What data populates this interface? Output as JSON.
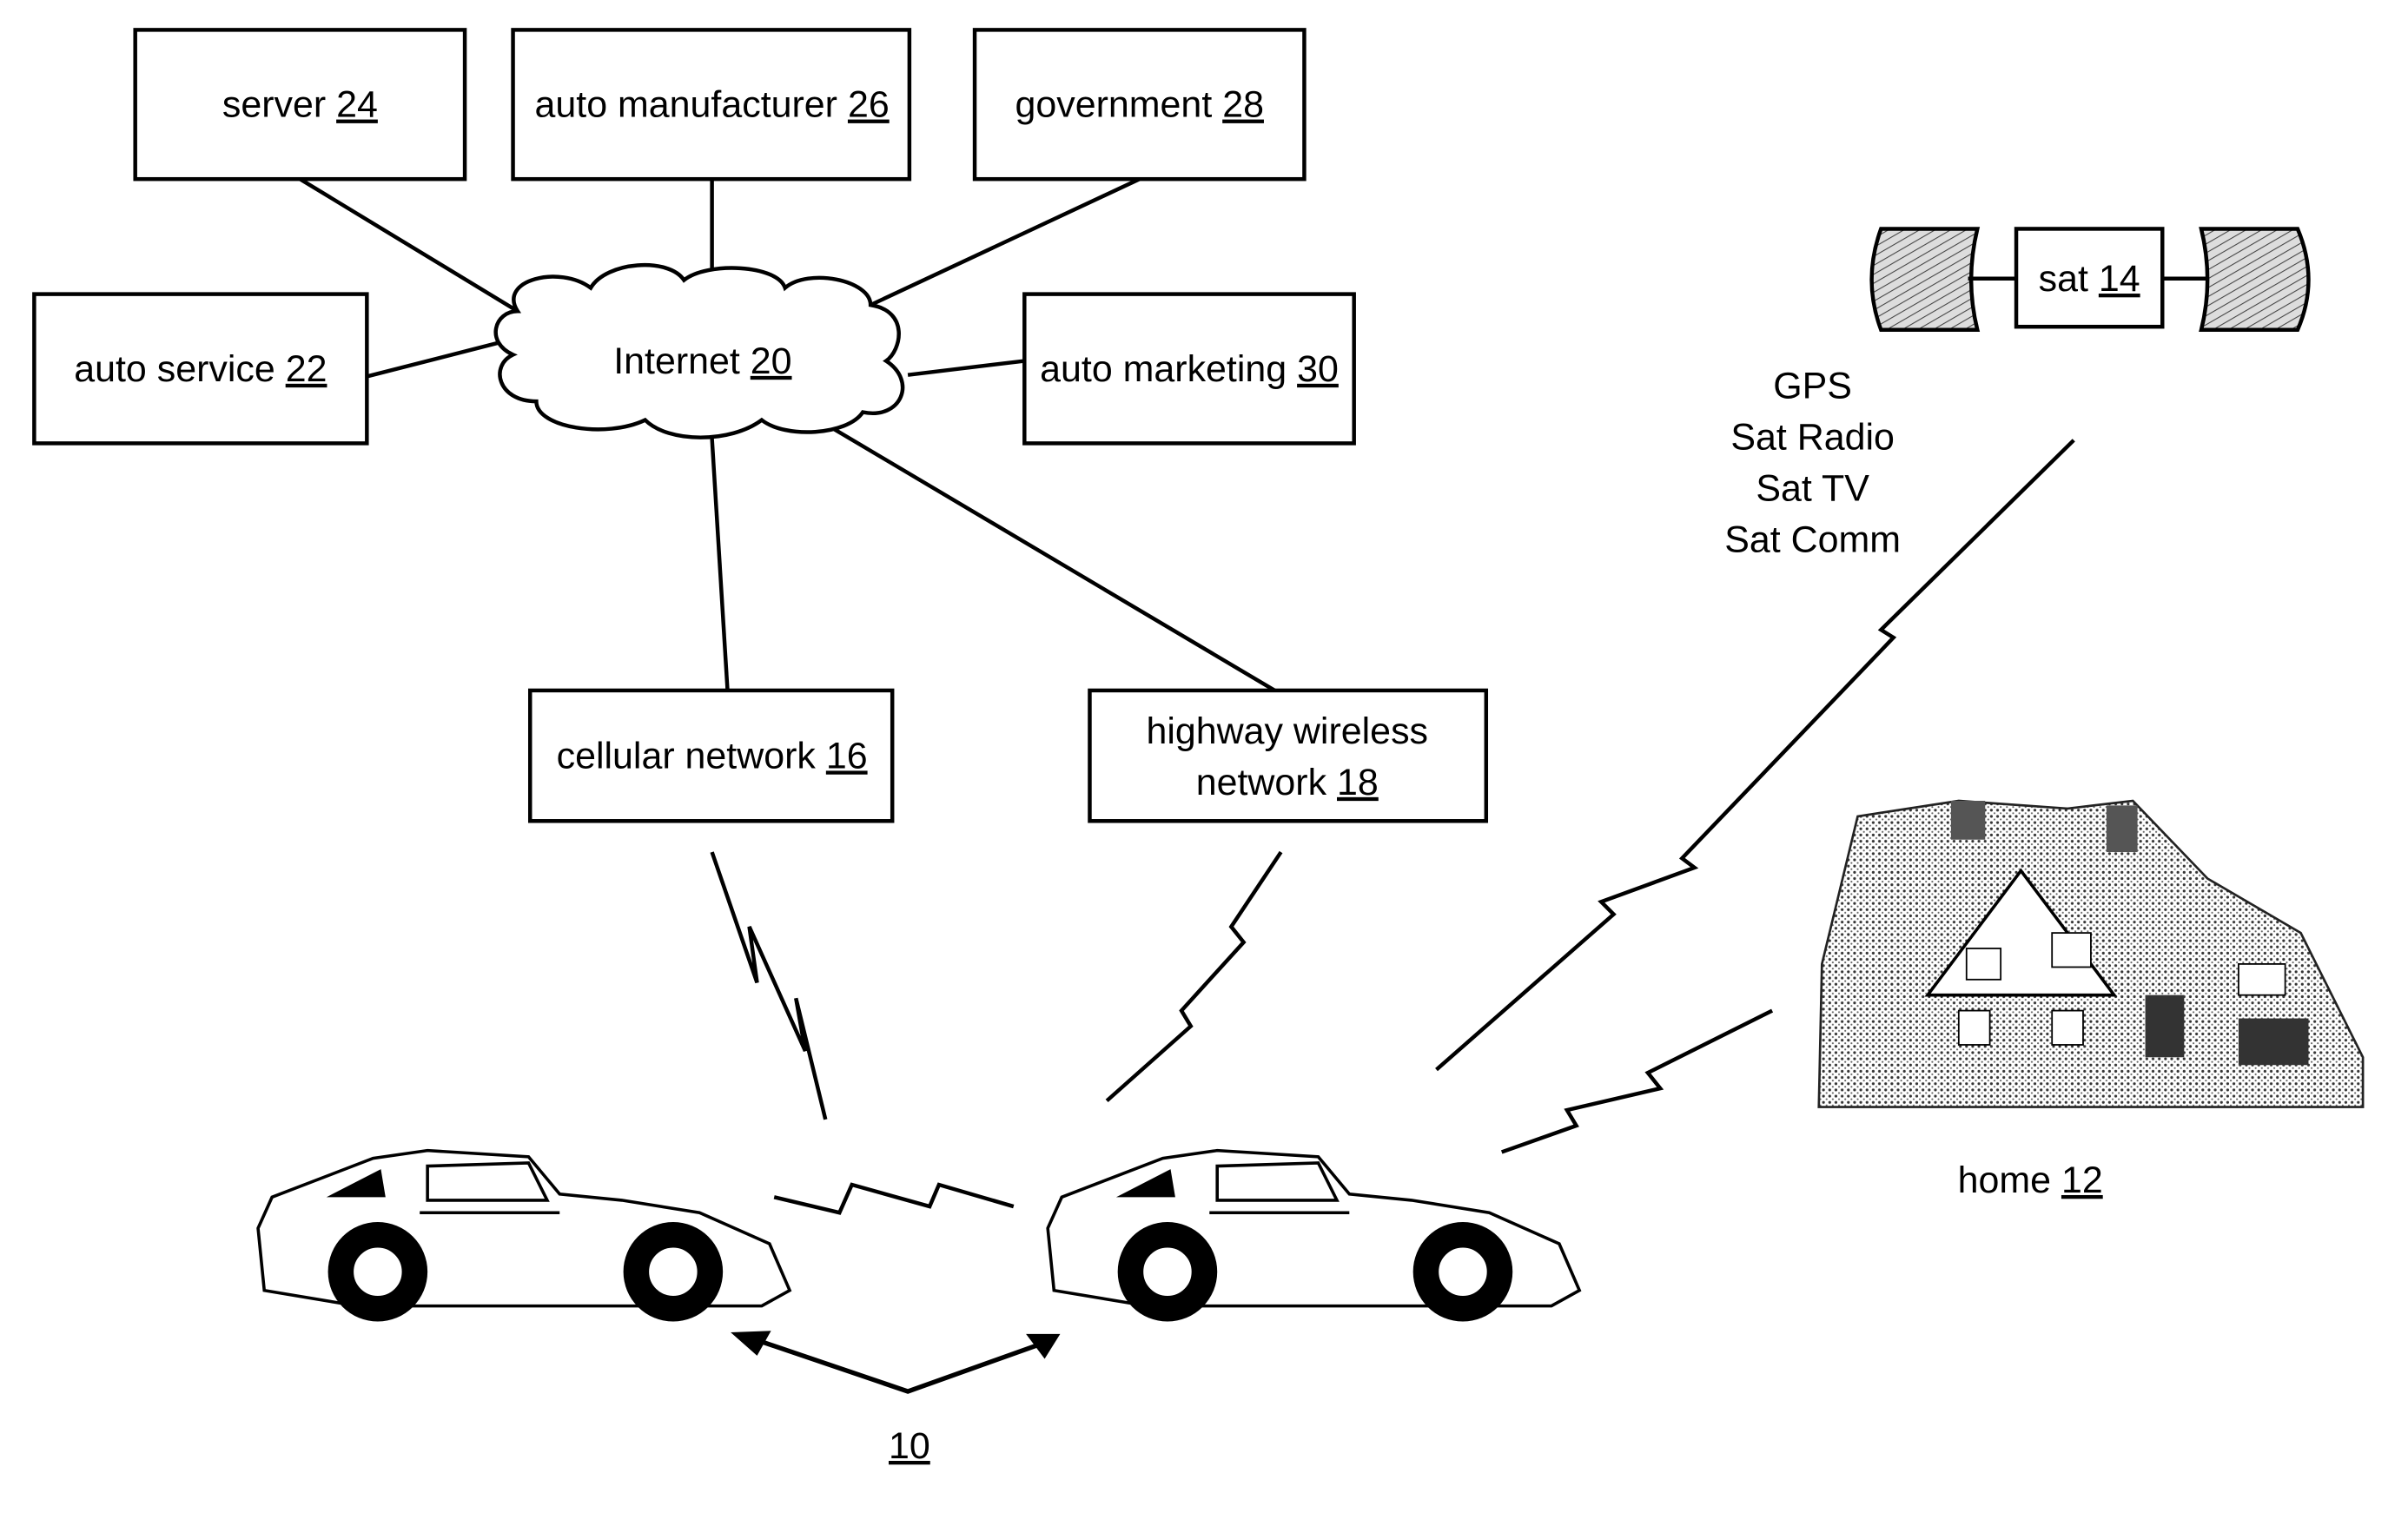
{
  "diagram": {
    "nodes": {
      "server": {
        "label": "server",
        "ref": "24"
      },
      "auto_manufacturer": {
        "label": "auto manufacturer",
        "ref": "26"
      },
      "government": {
        "label": "government",
        "ref": "28"
      },
      "auto_service": {
        "label": "auto service",
        "ref": "22"
      },
      "internet": {
        "label": "Internet",
        "ref": "20"
      },
      "auto_marketing": {
        "label": "auto marketing",
        "ref": "30"
      },
      "cellular_network": {
        "label": "cellular network",
        "ref": "16"
      },
      "highway_wireless": {
        "label_line1": "highway wireless",
        "label_line2": "network",
        "ref": "18"
      },
      "satellite": {
        "label": "sat",
        "ref": "14"
      },
      "home": {
        "label": "home",
        "ref": "12"
      },
      "vehicles": {
        "ref": "10"
      }
    },
    "satellite_services": [
      "GPS",
      "Sat Radio",
      "Sat TV",
      "Sat Comm"
    ]
  }
}
